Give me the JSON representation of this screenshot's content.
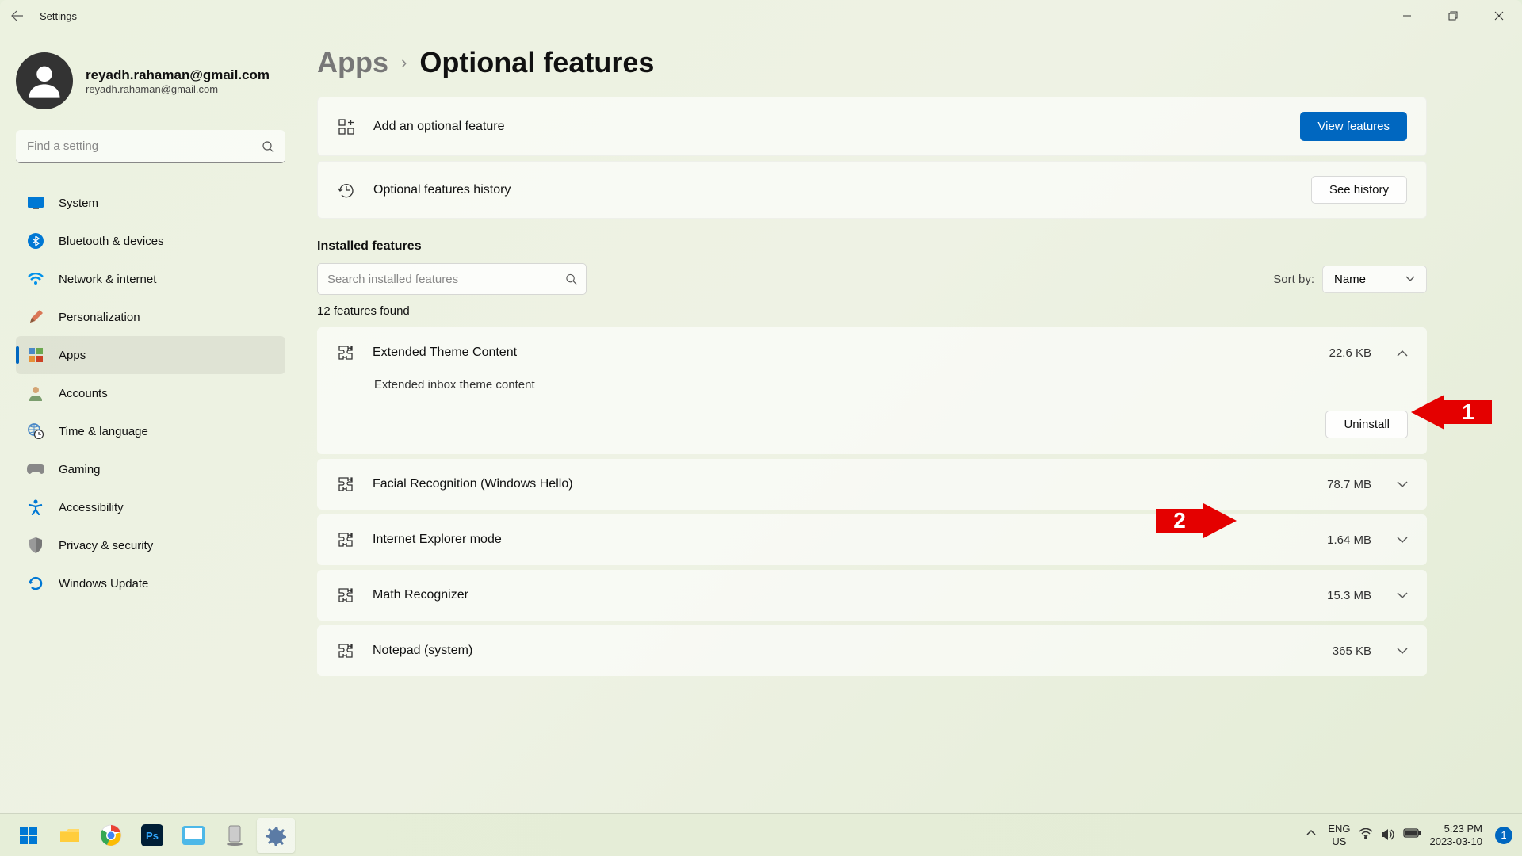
{
  "window": {
    "title": "Settings"
  },
  "user": {
    "name": "reyadh.rahaman@gmail.com",
    "email": "reyadh.rahaman@gmail.com"
  },
  "search": {
    "placeholder": "Find a setting"
  },
  "nav": [
    {
      "label": "System"
    },
    {
      "label": "Bluetooth & devices"
    },
    {
      "label": "Network & internet"
    },
    {
      "label": "Personalization"
    },
    {
      "label": "Apps"
    },
    {
      "label": "Accounts"
    },
    {
      "label": "Time & language"
    },
    {
      "label": "Gaming"
    },
    {
      "label": "Accessibility"
    },
    {
      "label": "Privacy & security"
    },
    {
      "label": "Windows Update"
    }
  ],
  "breadcrumb": {
    "parent": "Apps",
    "current": "Optional features"
  },
  "cards": {
    "add": {
      "label": "Add an optional feature",
      "button": "View features"
    },
    "history": {
      "label": "Optional features history",
      "button": "See history"
    }
  },
  "installed": {
    "title": "Installed features",
    "search_placeholder": "Search installed features",
    "sort_label": "Sort by:",
    "sort_value": "Name",
    "count": "12 features found"
  },
  "features": [
    {
      "name": "Extended Theme Content",
      "size": "22.6 KB",
      "expanded": true,
      "desc": "Extended inbox theme content",
      "uninstall": "Uninstall"
    },
    {
      "name": "Facial Recognition (Windows Hello)",
      "size": "78.7 MB"
    },
    {
      "name": "Internet Explorer mode",
      "size": "1.64 MB"
    },
    {
      "name": "Math Recognizer",
      "size": "15.3 MB"
    },
    {
      "name": "Notepad (system)",
      "size": "365 KB"
    }
  ],
  "annotations": {
    "a1": "1",
    "a2": "2"
  },
  "taskbar": {
    "lang1": "ENG",
    "lang2": "US",
    "time": "5:23 PM",
    "date": "2023-03-10",
    "notif": "1"
  }
}
